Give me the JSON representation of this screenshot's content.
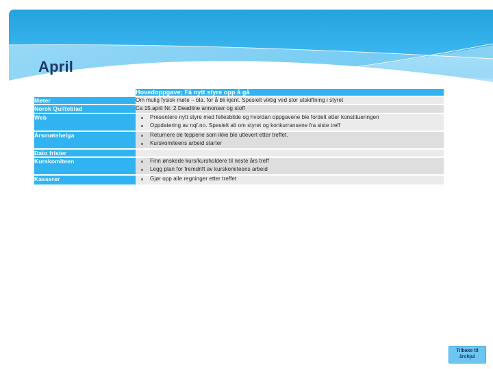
{
  "slide": {
    "title": "April",
    "theme_accent": "#30B3F0",
    "title_color": "#1F3864"
  },
  "table": {
    "header": {
      "label": "",
      "body": "Hovedoppgave; Få nytt styre opp å gå"
    },
    "rows": [
      {
        "label": "Møter",
        "type": "text",
        "text": "Om mulig fysisk møte – bla. for å bli kjent. Spesielt viktig ved stor utskiftning i styret"
      },
      {
        "label": "Norsk Quilteblad",
        "type": "text",
        "text": "Ca 15.april Nr. 2 Deadline annonser og stoff"
      },
      {
        "label": "Web",
        "type": "bullets",
        "bullets": [
          "Presentere nytt styre med fellesbilde og hvordan oppgavene ble fordelt etter konstitueringen",
          "Oppdatering av nqf.no. Spesielt alt om styret og konkurransene fra siste treff"
        ]
      },
      {
        "label": "Årsmøtehelga",
        "type": "bullets",
        "bullets": [
          "Returnere de teppene som ikke ble utlevert etter treffet.",
          "Kurskomiteens arbeid starter"
        ]
      },
      {
        "label": "Dato frister",
        "type": "text",
        "text": ""
      },
      {
        "label": "Kurskomiteen",
        "type": "bullets",
        "bullets": [
          "Finn ønskede kurs/kursholdere til neste års treff",
          "Legg plan for fremdrift av kurskomiteens arbeid"
        ]
      },
      {
        "label": "Kasserer",
        "type": "bullets",
        "bullets": [
          "Gjør opp alle regninger etter treffet"
        ]
      }
    ]
  },
  "nav": {
    "back_line1": "Tilbake til",
    "back_line2": "årshjul"
  }
}
